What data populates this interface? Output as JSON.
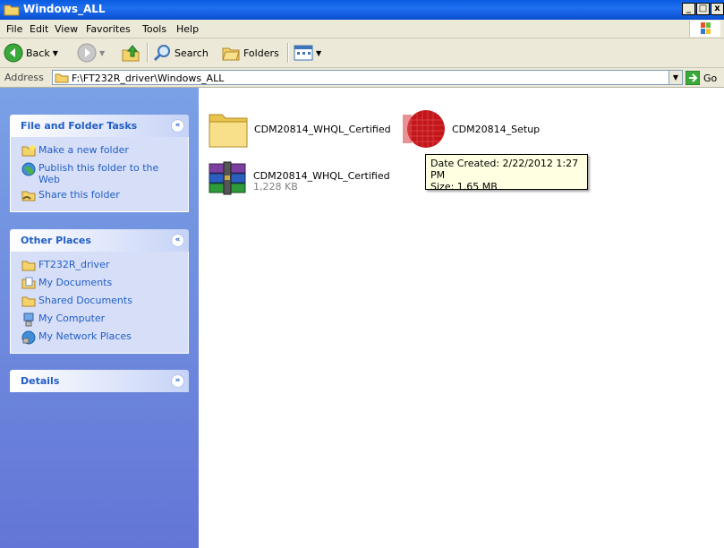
{
  "window": {
    "title": "Windows_ALL",
    "controls": [
      "_",
      "□",
      "x"
    ]
  },
  "menu": [
    "File",
    "Edit",
    "View",
    "Favorites",
    "Tools",
    "Help"
  ],
  "toolbar": {
    "back_label": "Back",
    "search_label": "Search",
    "folders_label": "Folders"
  },
  "address": {
    "label": "Address",
    "value": "F:\\FT232R_driver\\Windows_ALL",
    "go_label": "Go"
  },
  "tasks_panel": {
    "title": "File and Folder Tasks",
    "items": [
      "Make a new folder",
      "Publish this folder to the Web",
      "Share this folder"
    ]
  },
  "places_panel": {
    "title": "Other Places",
    "items": [
      "FT232R_driver",
      "My Documents",
      "Shared Documents",
      "My Computer",
      "My Network Places"
    ]
  },
  "details_panel": {
    "title": "Details"
  },
  "files": [
    {
      "name": "CDM20814_WHQL_Certified",
      "type": "folder"
    },
    {
      "name": "CDM20814_Setup",
      "type": "application"
    },
    {
      "name": "CDM20814_WHQL_Certified",
      "type": "rar-archive",
      "size": "1,228 KB"
    }
  ],
  "tooltip": {
    "line1": "Date Created: 2/22/2012 1:27 PM",
    "line2": "Size: 1.65 MB"
  },
  "colors": {
    "titlebar": "#0a5ae0",
    "taskpane_link": "#215dc6",
    "taskpane_bg": "#6375d6",
    "chrome": "#ece9d8",
    "tooltip_bg": "#ffffe1"
  }
}
